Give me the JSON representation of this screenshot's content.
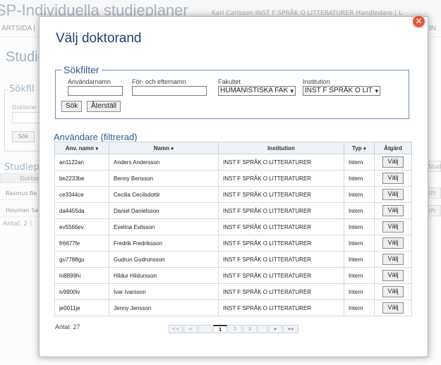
{
  "background": {
    "title": "SP-Individuella studieplaner",
    "top_right": "Karl Carlsson  INST F SPRÅK O LITTERATURER   Handledare  |  L",
    "nav_left": "ARTSIDA |",
    "nav_right": "IN",
    "section_title": "Studie",
    "search_legend": "Sökfil",
    "doktorand_label": "Doktorar",
    "search_button": "Sök",
    "studieplaner_title": "Studiepl",
    "table_header": "Doktor",
    "rows": [
      "Rasmus Be",
      "Houman Sa"
    ],
    "right_cells": [
      "Stud",
      "(Pl",
      "(Pl"
    ],
    "antal": "Antal: 2 ("
  },
  "modal": {
    "title": "Välj doktorand",
    "close_icon": "close-icon",
    "filter": {
      "legend": "Sökfilter",
      "username_label": "Användarnamn",
      "username_value": "",
      "name_label": "För- och efternamn",
      "name_value": "",
      "faculty_label": "Fakultet",
      "faculty_value": "HUMANISTISKA FAK",
      "institution_label": "Institution",
      "institution_value": "INST F SPRÅK O LIT",
      "search_button": "Sök",
      "reset_button": "Återställ"
    },
    "users": {
      "title": "Användare (filtrerad)",
      "headers": [
        "Anv. namn ♦",
        "Namn ♦",
        "Institution",
        "Typ ♦",
        "Åtgärd"
      ],
      "rows": [
        {
          "username": "an1122an",
          "name": "Anders Andersson",
          "institution": "INST F SPRÅK O LITTERATURER",
          "type": "Intern",
          "action": "Välj"
        },
        {
          "username": "be2233be",
          "name": "Benny Bensson",
          "institution": "INST F SPRÅK O LITTERATURER",
          "type": "Intern",
          "action": "Välj"
        },
        {
          "username": "ce3344ce",
          "name": "Cecilia Cecilsdottir",
          "institution": "INST F SPRÅK O LITTERATURER",
          "type": "Intern",
          "action": "Välj"
        },
        {
          "username": "da4455da",
          "name": "Daniel Danielsson",
          "institution": "INST F SPRÅK O LITTERATURER",
          "type": "Intern",
          "action": "Välj"
        },
        {
          "username": "ev5566ev",
          "name": "Evelina Evilsson",
          "institution": "INST F SPRÅK O LITTERATURER",
          "type": "Intern",
          "action": "Välj"
        },
        {
          "username": "fr6677fe",
          "name": "Fredrik Fredriksson",
          "institution": "INST F SPRÅK O LITTERATURER",
          "type": "Intern",
          "action": "Välj"
        },
        {
          "username": "gu7788gu",
          "name": "Gudrun Gudrunsson",
          "institution": "INST F SPRÅK O LITTERATURER",
          "type": "Intern",
          "action": "Välj"
        },
        {
          "username": "hi8899hi",
          "name": "Hildur Hildursson",
          "institution": "INST F SPRÅK O LITTERATURER",
          "type": "Intern",
          "action": "Välj"
        },
        {
          "username": "iv9900iv",
          "name": "Ivar Ivarsson",
          "institution": "INST F SPRÅK O LITTERATURER",
          "type": "Intern",
          "action": "Välj"
        },
        {
          "username": "je0011je",
          "name": "Jenny Jensson",
          "institution": "INST F SPRÅK O LITTERATURER",
          "type": "Intern",
          "action": "Välj"
        }
      ]
    },
    "antal": "Antal: 27",
    "pager": {
      "first": "<<",
      "prev": "<",
      "pages": [
        "1",
        "2",
        "3"
      ],
      "current_page": "1",
      "next": "»",
      "last": "»»"
    }
  },
  "colors": {
    "title_blue": "#1f3f6e",
    "legend_blue": "#2a5d8f",
    "close_red": "#e25b3e"
  }
}
